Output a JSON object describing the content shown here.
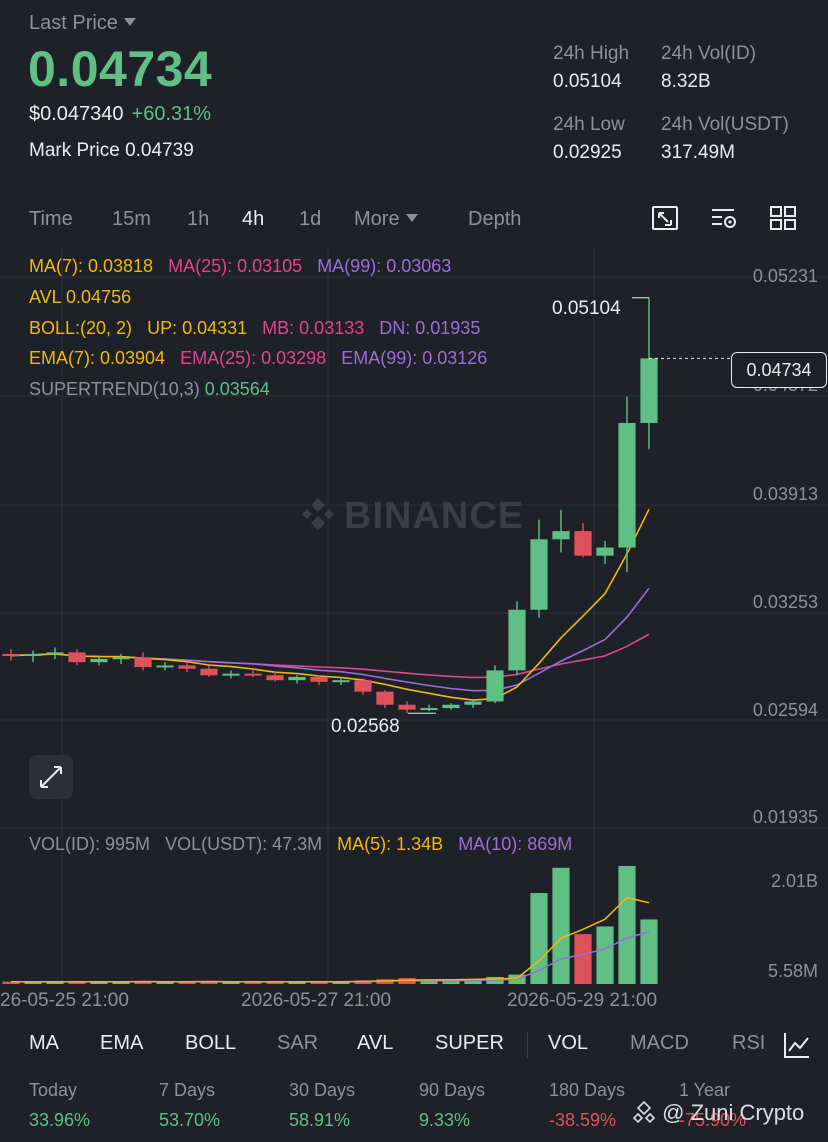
{
  "header": {
    "last_price_label": "Last Price",
    "last_price": "0.04734",
    "usd_price": "$0.047340",
    "change_pct": "+60.31%",
    "mark_price_label": "Mark Price",
    "mark_price": "0.04739"
  },
  "stats": {
    "high_label": "24h High",
    "high_value": "0.05104",
    "vol_id_label": "24h Vol(ID)",
    "vol_id_value": "8.32B",
    "low_label": "24h Low",
    "low_value": "0.02925",
    "vol_usdt_label": "24h Vol(USDT)",
    "vol_usdt_value": "317.49M"
  },
  "timeframes": {
    "time": "Time",
    "m15": "15m",
    "h1": "1h",
    "h4": "4h",
    "d1": "1d",
    "more": "More",
    "depth": "Depth",
    "active": "4h"
  },
  "indicators": {
    "ma7": "MA(7): 0.03818",
    "ma25": "MA(25): 0.03105",
    "ma99": "MA(99): 0.03063",
    "avl": "AVL 0.04756",
    "boll": "BOLL:(20, 2)",
    "boll_up": "UP: 0.04331",
    "boll_mb": "MB: 0.03133",
    "boll_dn": "DN: 0.01935",
    "ema7": "EMA(7): 0.03904",
    "ema25": "EMA(25): 0.03298",
    "ema99": "EMA(99): 0.03126",
    "supertrend_label": "SUPERTREND(10,3)",
    "supertrend_value": "0.03564"
  },
  "chart": {
    "watermark": "BINANCE",
    "current_price_tag": "0.04734",
    "high_marker": "0.05104",
    "low_marker": "0.02568",
    "price_axis": [
      "0.05231",
      "0.04572",
      "0.03913",
      "0.03253",
      "0.02594",
      "0.01935"
    ],
    "volume_axis": [
      "2.01B",
      "5.58M"
    ],
    "dates": [
      "26-05-25 21:00",
      "2026-05-27 21:00",
      "2026-05-29 21:00"
    ],
    "vol_indicators": {
      "vol_id": "VOL(ID): 995M",
      "vol_usdt": "VOL(USDT): 47.3M",
      "ma5": "MA(5): 1.34B",
      "ma10": "MA(10): 869M"
    },
    "colors": {
      "up": "#5fbf85",
      "down": "#e0525b",
      "ma7": "#f0b90b",
      "ma25": "#e0468f",
      "ma99": "#9a6fd6"
    }
  },
  "chart_data": {
    "type": "candlestick",
    "title": "",
    "candles": [
      {
        "o": 0.0293,
        "h": 0.0296,
        "l": 0.0289,
        "c": 0.0292
      },
      {
        "o": 0.0292,
        "h": 0.0295,
        "l": 0.0288,
        "c": 0.0293
      },
      {
        "o": 0.0293,
        "h": 0.0297,
        "l": 0.029,
        "c": 0.0294
      },
      {
        "o": 0.0294,
        "h": 0.0296,
        "l": 0.0286,
        "c": 0.0288
      },
      {
        "o": 0.0288,
        "h": 0.0292,
        "l": 0.0286,
        "c": 0.029
      },
      {
        "o": 0.029,
        "h": 0.0293,
        "l": 0.0287,
        "c": 0.0291
      },
      {
        "o": 0.0291,
        "h": 0.0294,
        "l": 0.0283,
        "c": 0.0285
      },
      {
        "o": 0.0285,
        "h": 0.0288,
        "l": 0.0283,
        "c": 0.0286
      },
      {
        "o": 0.0286,
        "h": 0.0288,
        "l": 0.0282,
        "c": 0.0284
      },
      {
        "o": 0.0284,
        "h": 0.0286,
        "l": 0.0279,
        "c": 0.028
      },
      {
        "o": 0.028,
        "h": 0.0283,
        "l": 0.0278,
        "c": 0.0281
      },
      {
        "o": 0.0281,
        "h": 0.0283,
        "l": 0.0279,
        "c": 0.028
      },
      {
        "o": 0.028,
        "h": 0.0282,
        "l": 0.0276,
        "c": 0.0277
      },
      {
        "o": 0.0277,
        "h": 0.028,
        "l": 0.0275,
        "c": 0.0279
      },
      {
        "o": 0.0279,
        "h": 0.028,
        "l": 0.0274,
        "c": 0.0276
      },
      {
        "o": 0.0276,
        "h": 0.0279,
        "l": 0.0274,
        "c": 0.0277
      },
      {
        "o": 0.0277,
        "h": 0.0278,
        "l": 0.0268,
        "c": 0.027
      },
      {
        "o": 0.027,
        "h": 0.0271,
        "l": 0.026,
        "c": 0.0262
      },
      {
        "o": 0.0262,
        "h": 0.0264,
        "l": 0.02568,
        "c": 0.0259
      },
      {
        "o": 0.0259,
        "h": 0.0262,
        "l": 0.0258,
        "c": 0.026
      },
      {
        "o": 0.026,
        "h": 0.0263,
        "l": 0.0259,
        "c": 0.0262
      },
      {
        "o": 0.0262,
        "h": 0.0265,
        "l": 0.026,
        "c": 0.0264
      },
      {
        "o": 0.0264,
        "h": 0.0286,
        "l": 0.0263,
        "c": 0.0283
      },
      {
        "o": 0.0283,
        "h": 0.0325,
        "l": 0.028,
        "c": 0.032
      },
      {
        "o": 0.032,
        "h": 0.0375,
        "l": 0.0315,
        "c": 0.0363
      },
      {
        "o": 0.0363,
        "h": 0.0381,
        "l": 0.0355,
        "c": 0.0368
      },
      {
        "o": 0.0368,
        "h": 0.0373,
        "l": 0.0352,
        "c": 0.0353
      },
      {
        "o": 0.0353,
        "h": 0.0362,
        "l": 0.0348,
        "c": 0.0358
      },
      {
        "o": 0.0358,
        "h": 0.045,
        "l": 0.0343,
        "c": 0.0434
      },
      {
        "o": 0.0434,
        "h": 0.05104,
        "l": 0.0418,
        "c": 0.04734
      }
    ],
    "volume": [
      0.04,
      0.03,
      0.05,
      0.04,
      0.03,
      0.04,
      0.05,
      0.03,
      0.04,
      0.05,
      0.03,
      0.04,
      0.04,
      0.03,
      0.05,
      0.04,
      0.06,
      0.08,
      0.1,
      0.07,
      0.06,
      0.08,
      0.12,
      0.16,
      1.55,
      1.98,
      0.85,
      0.98,
      2.01,
      1.1
    ],
    "ylim": [
      0.01935,
      0.05231
    ],
    "volume_ylim": [
      0,
      2.01
    ]
  },
  "bottom_tabs": [
    "MA",
    "EMA",
    "BOLL",
    "SAR",
    "AVL",
    "SUPER",
    "VOL",
    "MACD",
    "RSI"
  ],
  "bottom_tabs_off": [
    "SAR",
    "MACD",
    "RSI"
  ],
  "performance": [
    {
      "label": "Today",
      "value": "33.96%",
      "dir": "up"
    },
    {
      "label": "7 Days",
      "value": "53.70%",
      "dir": "up"
    },
    {
      "label": "30 Days",
      "value": "58.91%",
      "dir": "up"
    },
    {
      "label": "90 Days",
      "value": "9.33%",
      "dir": "up"
    },
    {
      "label": "180 Days",
      "value": "-38.59%",
      "dir": "down"
    },
    {
      "label": "1 Year",
      "value": "-75.90%",
      "dir": "down"
    }
  ],
  "overlay_credit": "@ Zuni Crypto"
}
